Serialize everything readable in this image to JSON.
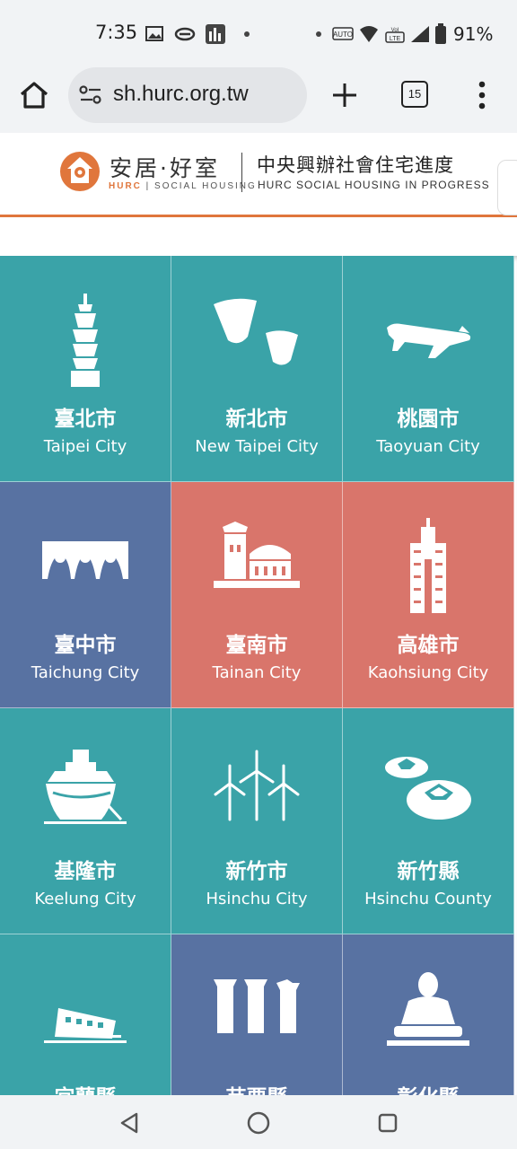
{
  "status": {
    "time": "7:35",
    "battery": "91%"
  },
  "browser": {
    "url": "sh.hurc.org.tw",
    "tab_count": "15"
  },
  "site": {
    "logo_title": "安居·好室",
    "logo_sub_brand": "HURC",
    "logo_sub_text": "SOCIAL HOUSING",
    "header_zh": "中央興辦社會住宅進度",
    "header_en": "HURC SOCIAL HOUSING IN PROGRESS"
  },
  "colors": {
    "teal": "#3aa3a8",
    "blue": "#5872a2",
    "coral": "#d9756b",
    "orange": "#e0763c"
  },
  "cities": [
    {
      "zh": "臺北市",
      "en": "Taipei City",
      "icon": "taipei-101-icon"
    },
    {
      "zh": "新北市",
      "en": "New Taipei City",
      "icon": "sky-lantern-icon"
    },
    {
      "zh": "桃園市",
      "en": "Taoyuan City",
      "icon": "airplane-icon"
    },
    {
      "zh": "臺中市",
      "en": "Taichung City",
      "icon": "opera-house-icon"
    },
    {
      "zh": "臺南市",
      "en": "Tainan City",
      "icon": "fort-icon"
    },
    {
      "zh": "高雄市",
      "en": "Kaohsiung City",
      "icon": "skyscraper-icon"
    },
    {
      "zh": "基隆市",
      "en": "Keelung City",
      "icon": "ship-icon"
    },
    {
      "zh": "新竹市",
      "en": "Hsinchu City",
      "icon": "wind-turbine-icon"
    },
    {
      "zh": "新竹縣",
      "en": "Hsinchu County",
      "icon": "persimmon-icon"
    },
    {
      "zh": "宜蘭縣",
      "en": "",
      "icon": "tilted-building-icon"
    },
    {
      "zh": "苗栗縣",
      "en": "",
      "icon": "ruins-columns-icon"
    },
    {
      "zh": "彰化縣",
      "en": "",
      "icon": "buddha-icon"
    }
  ]
}
